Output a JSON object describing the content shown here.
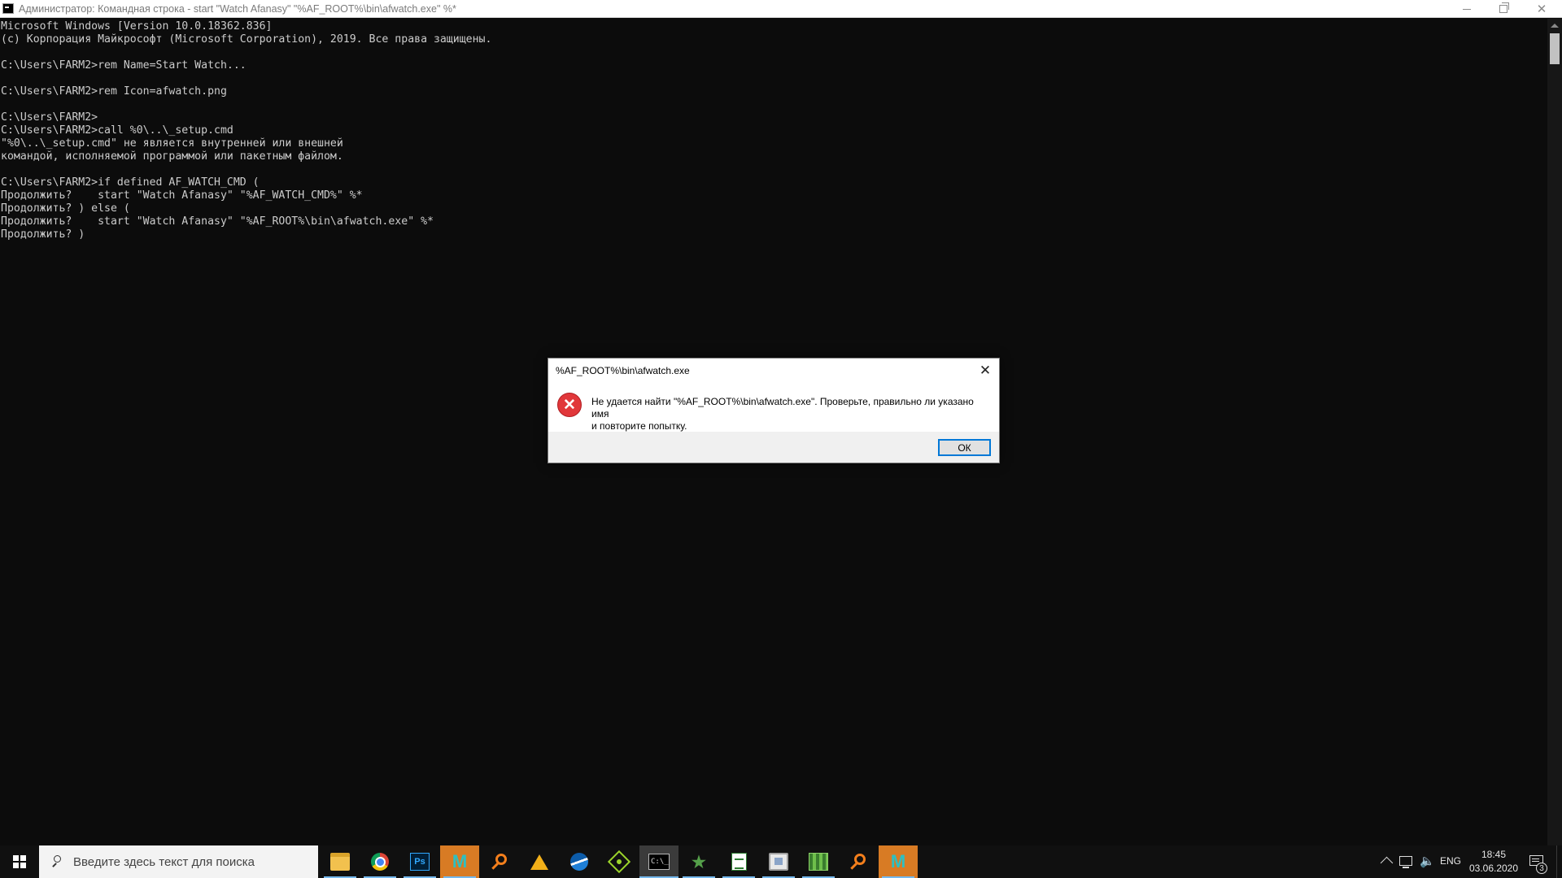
{
  "window": {
    "title": "Администратор: Командная строка - start  \"Watch Afanasy\" \"%AF_ROOT%\\bin\\afwatch.exe\" %*"
  },
  "console": {
    "lines": [
      "Microsoft Windows [Version 10.0.18362.836]",
      "(c) Корпорация Майкрософт (Microsoft Corporation), 2019. Все права защищены.",
      "",
      "C:\\Users\\FARM2>rem Name=Start Watch...",
      "",
      "C:\\Users\\FARM2>rem Icon=afwatch.png",
      "",
      "C:\\Users\\FARM2>",
      "C:\\Users\\FARM2>call %0\\..\\_setup.cmd",
      "\"%0\\..\\_setup.cmd\" не является внутренней или внешней",
      "командой, исполняемой программой или пакетным файлом.",
      "",
      "C:\\Users\\FARM2>if defined AF_WATCH_CMD (",
      "Продолжить?    start \"Watch Afanasy\" \"%AF_WATCH_CMD%\" %*",
      "Продолжить? ) else (",
      "Продолжить?    start \"Watch Afanasy\" \"%AF_ROOT%\\bin\\afwatch.exe\" %*",
      "Продолжить? )"
    ]
  },
  "dialog": {
    "title": "%AF_ROOT%\\bin\\afwatch.exe",
    "message_line1": "Не удается найти \"%AF_ROOT%\\bin\\afwatch.exe\". Проверьте, правильно ли указано имя",
    "message_line2": "и повторите попытку.",
    "ok_label": "ОК",
    "close_glyph": "✕",
    "icon_glyph": "✕"
  },
  "taskbar": {
    "search_placeholder": "Введите здесь текст для поиска",
    "apps": [
      {
        "name": "file-explorer-icon",
        "label": "",
        "running": true
      },
      {
        "name": "chrome-icon",
        "label": "",
        "running": true
      },
      {
        "name": "photoshop-icon",
        "label": "Ps",
        "running": true
      },
      {
        "name": "maya-icon",
        "label": "M",
        "running": true
      },
      {
        "name": "keyfinder-icon",
        "label": "",
        "running": false
      },
      {
        "name": "triangle-app-icon",
        "label": "",
        "running": false
      },
      {
        "name": "wave-app-icon",
        "label": "",
        "running": false
      },
      {
        "name": "target-app-icon",
        "label": "",
        "running": false
      },
      {
        "name": "command-prompt-icon",
        "label": "C:\\_",
        "running": true
      },
      {
        "name": "star-app-icon",
        "label": "★",
        "running": true
      },
      {
        "name": "spreadsheet-icon",
        "label": "",
        "running": true
      },
      {
        "name": "monitor-app-icon",
        "label": "",
        "running": true
      },
      {
        "name": "grid-app-icon",
        "label": "",
        "running": true
      },
      {
        "name": "keyfinder-icon-2",
        "label": "",
        "running": false
      },
      {
        "name": "maya-icon-2",
        "label": "M",
        "running": true
      }
    ],
    "tray": {
      "language": "ENG",
      "time": "18:45",
      "date": "03.06.2020",
      "notification_count": "3",
      "volume_glyph": "🔈"
    }
  },
  "colors": {
    "console_bg": "#0c0c0c",
    "console_text": "#cccccc",
    "accent": "#0078d7",
    "error_red": "#e1373a",
    "taskbar_bg": "#101010",
    "running_indicator": "#76b9ed"
  }
}
